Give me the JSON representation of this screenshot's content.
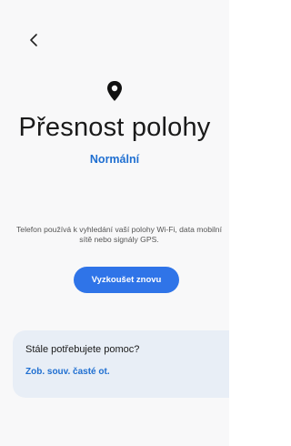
{
  "header": {
    "back_icon": "chevron-left-icon"
  },
  "main": {
    "icon": "location-pin-icon",
    "title": "Přesnost polohy",
    "subtitle": "Normální",
    "description": "Telefon používá k vyhledání vaší polohy Wi-Fi, data mobilní sítě nebo signály GPS.",
    "retry_label": "Vyzkoušet znovu"
  },
  "help": {
    "title": "Stále potřebujete pomoc?",
    "link_label": "Zob. souv. časté ot."
  },
  "colors": {
    "accent": "#2f74e8",
    "link": "#1f6fd1",
    "card_bg": "#e8eef6",
    "background": "#f8f8f9"
  }
}
